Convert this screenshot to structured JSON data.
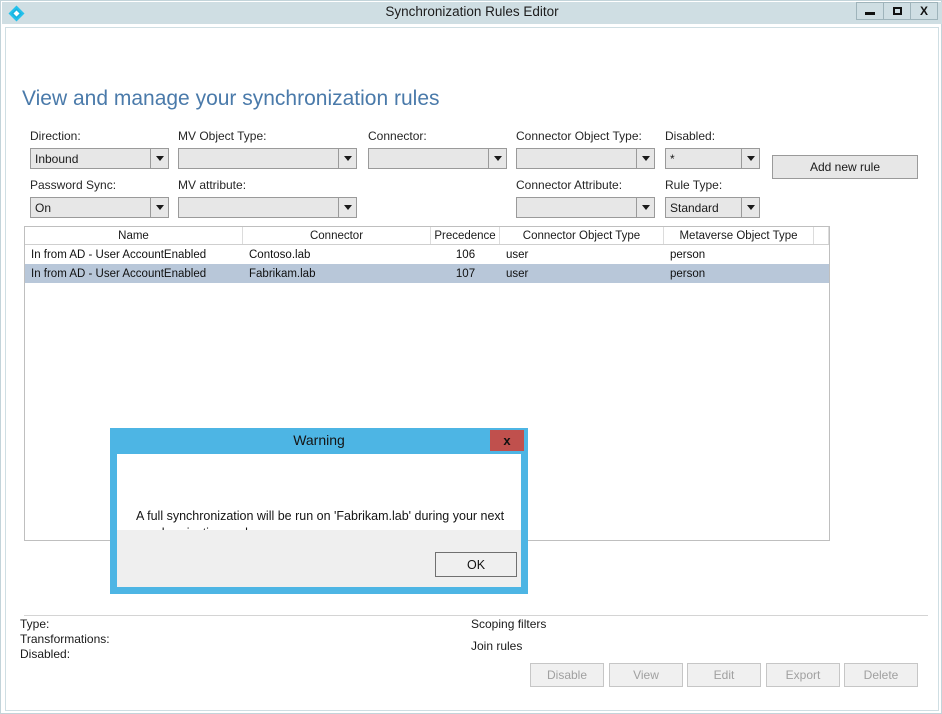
{
  "window": {
    "title": "Synchronization Rules Editor",
    "icon": "diamond-compass-icon",
    "minimize_label": "Minimize",
    "maximize_label": "Maximize",
    "close_label": "X",
    "accent_color": "#4db5e4",
    "titlebar_color": "#cfdee3"
  },
  "page": {
    "heading": "View and manage your synchronization rules",
    "heading_color": "#4a7aaa"
  },
  "filters": {
    "direction": {
      "label": "Direction:",
      "value": "Inbound"
    },
    "mv_object_type": {
      "label": "MV Object Type:",
      "value": ""
    },
    "connector": {
      "label": "Connector:",
      "value": ""
    },
    "connector_object_type": {
      "label": "Connector Object Type:",
      "value": ""
    },
    "disabled": {
      "label": "Disabled:",
      "value": "*"
    },
    "password_sync": {
      "label": "Password Sync:",
      "value": "On"
    },
    "mv_attribute": {
      "label": "MV attribute:",
      "value": ""
    },
    "connector_attribute": {
      "label": "Connector Attribute:",
      "value": ""
    },
    "rule_type": {
      "label": "Rule Type:",
      "value": "Standard"
    }
  },
  "actions": {
    "add_new_rule": "Add new rule"
  },
  "grid": {
    "columns": [
      "Name",
      "Connector",
      "Precedence",
      "Connector Object Type",
      "Metaverse Object Type",
      ""
    ],
    "rows": [
      {
        "name": "In from AD - User AccountEnabled",
        "connector": "Contoso.lab",
        "precedence": "106",
        "connector_object_type": "user",
        "metaverse_object_type": "person",
        "selected": false
      },
      {
        "name": "In from AD - User AccountEnabled",
        "connector": "Fabrikam.lab",
        "precedence": "107",
        "connector_object_type": "user",
        "metaverse_object_type": "person",
        "selected": true
      }
    ],
    "selection_color": "#b8c7d9"
  },
  "details": {
    "type_label": "Type:",
    "transformations_label": "Transformations:",
    "disabled_label": "Disabled:",
    "scoping_filters_label": "Scoping filters",
    "join_rules_label": "Join rules"
  },
  "footer_buttons": [
    {
      "label": "Disable",
      "disabled": true
    },
    {
      "label": "View",
      "disabled": true
    },
    {
      "label": "Edit",
      "disabled": true
    },
    {
      "label": "Export",
      "disabled": true
    },
    {
      "label": "Delete",
      "disabled": true
    }
  ],
  "dialog": {
    "title": "Warning",
    "close_label": "x",
    "message": "A full synchronization will be run on 'Fabrikam.lab' during your next synchronization cycle.",
    "ok_label": "OK",
    "border_color": "#4db5e4",
    "close_button_color": "#c0504d"
  }
}
